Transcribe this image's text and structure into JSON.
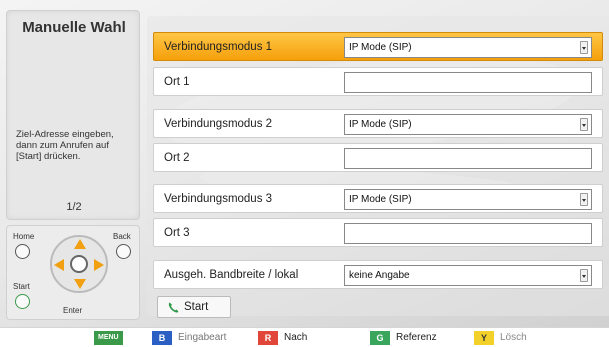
{
  "left_panel": {
    "title": "Manuelle Wahl",
    "help_text": "Ziel-Adresse eingeben, dann zum Anrufen auf [Start] drücken.",
    "page_indicator": "1/2"
  },
  "remote": {
    "home_label": "Home",
    "back_label": "Back",
    "start_label": "Start",
    "enter_label": "Enter"
  },
  "form": {
    "rows": [
      {
        "label": "Verbindungsmodus 1",
        "type": "select",
        "value": "IP Mode (SIP)",
        "active": true
      },
      {
        "label": "Ort 1",
        "type": "text",
        "value": ""
      },
      {
        "label": "Verbindungsmodus 2",
        "type": "select",
        "value": "IP Mode (SIP)"
      },
      {
        "label": "Ort 2",
        "type": "text",
        "value": ""
      },
      {
        "label": "Verbindungsmodus 3",
        "type": "select",
        "value": "IP Mode (SIP)"
      },
      {
        "label": "Ort 3",
        "type": "text",
        "value": ""
      },
      {
        "label": "Ausgeh. Bandbreite / lokal",
        "type": "select",
        "value": "keine Angabe"
      }
    ],
    "start_button": "Start"
  },
  "bottom_bar": {
    "menu_key": "MENU",
    "b_key": "B",
    "b_label": "Eingabeart",
    "r_key": "R",
    "r_label": "Nach",
    "g_key": "G",
    "g_label": "Referenz",
    "y_key": "Y",
    "y_label": "Lösch",
    "colors": {
      "menu": "#3a9a4a",
      "b": "#2b5fc4",
      "r": "#e0463a",
      "g": "#3aa65c",
      "y": "#f2d12b"
    }
  },
  "colors": {
    "active_row": "#f5a00b",
    "accent": "#f0a010"
  }
}
